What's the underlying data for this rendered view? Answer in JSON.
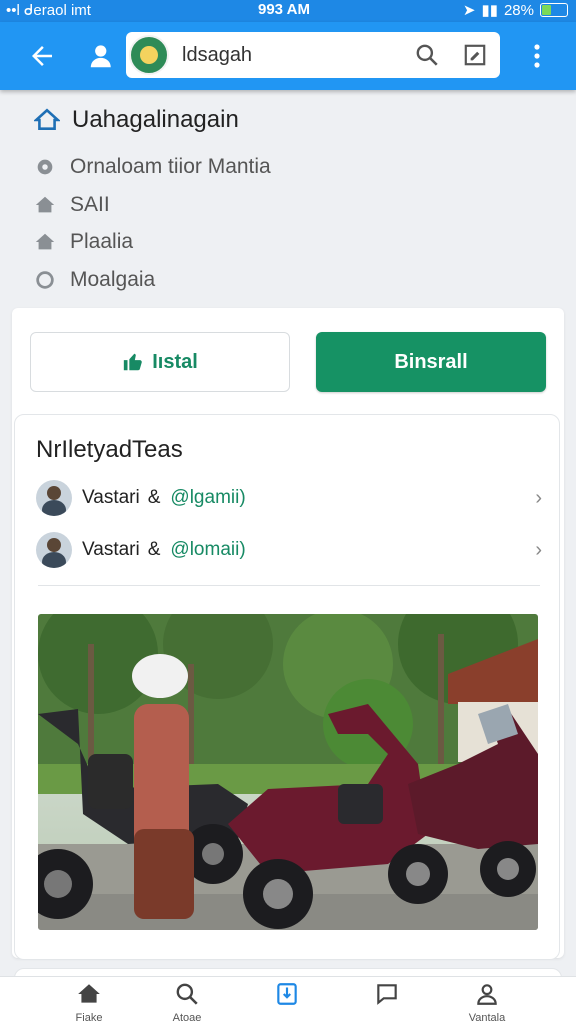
{
  "status_bar": {
    "carrier": "••l ᑯeraol  imt",
    "time": "993 AM",
    "battery": "28%"
  },
  "app_bar": {
    "search_query": "ldsagah",
    "icons": [
      "back-arrow-icon",
      "profile-icon",
      "search-icon",
      "edit-square-icon",
      "more-vert-icon"
    ]
  },
  "header": {
    "title": "Uahagalinagain",
    "rows": [
      {
        "icon": "location-pin-icon",
        "text": "Ornaloam tiior Mantia"
      },
      {
        "icon": "home-icon",
        "text": "SAII"
      },
      {
        "icon": "home-icon",
        "text": "Plaalia"
      },
      {
        "icon": "circle-icon",
        "text": "Moalgaia"
      }
    ]
  },
  "actions": {
    "install_label": "Iıstal",
    "primary_label": "Binsrall"
  },
  "section": {
    "title": "NrIletyadTeas",
    "contacts": [
      {
        "name": "Vastari",
        "amp": "&",
        "handle": "@lgamii)"
      },
      {
        "name": "Vastari",
        "amp": "&",
        "handle": "@lomaii)"
      }
    ]
  },
  "bottom_nav": [
    {
      "label": "Fiake",
      "icon": "home-icon"
    },
    {
      "label": "Atoae",
      "icon": "search-icon"
    },
    {
      "label": "",
      "icon": "bookmark-icon",
      "active": true
    },
    {
      "label": "",
      "icon": "chat-icon"
    },
    {
      "label": "Vantala",
      "icon": "person-star-icon"
    }
  ],
  "colors": {
    "app_bar": "#2196f3",
    "primary": "#169264",
    "accent_text": "#178a64"
  }
}
